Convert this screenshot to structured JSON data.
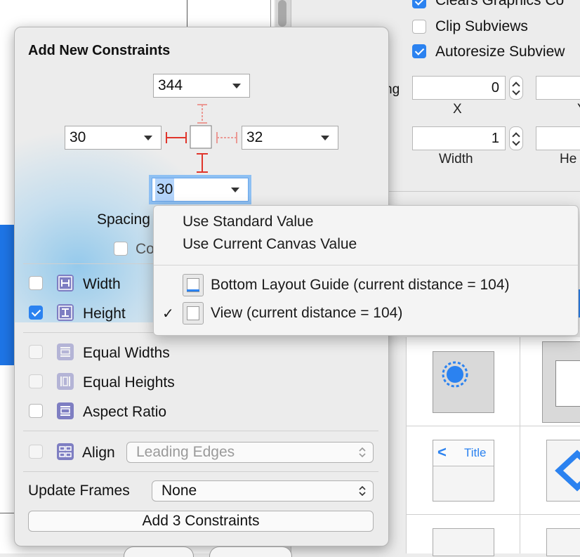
{
  "inspector": {
    "checkboxes": [
      {
        "label": "Clears Graphics Co",
        "checked": true
      },
      {
        "label": "Clip Subviews",
        "checked": false
      },
      {
        "label": "Autoresize Subview",
        "checked": true
      }
    ],
    "spacing_label_partial": "ng",
    "x_value": "0",
    "x_label": "X",
    "y_label_partial": "Y",
    "width_value": "1",
    "width_label": "Width",
    "height_label_partial": "He"
  },
  "object_library": {
    "nav_back_glyph": "<",
    "nav_title": "Title"
  },
  "popover": {
    "title": "Add New Constraints",
    "top_value": "344",
    "left_value": "30",
    "right_value": "32",
    "bottom_value": "30",
    "spacing_label_partial": "Spacing",
    "constrain_label_partial": "Co",
    "rows": [
      {
        "label": "Width",
        "checked": false,
        "enabled": true,
        "icon": "width-constraint-icon"
      },
      {
        "label": "Height",
        "checked": true,
        "enabled": true,
        "icon": "height-constraint-icon"
      },
      {
        "label": "Equal Widths",
        "checked": false,
        "enabled": false,
        "icon": "equal-widths-icon"
      },
      {
        "label": "Equal Heights",
        "checked": false,
        "enabled": false,
        "icon": "equal-heights-icon"
      },
      {
        "label": "Aspect Ratio",
        "checked": false,
        "enabled": true,
        "icon": "aspect-ratio-icon"
      }
    ],
    "align": {
      "label": "Align",
      "value": "Leading Edges",
      "enabled": false
    },
    "update_frames": {
      "label": "Update Frames",
      "value": "None"
    },
    "add_button": "Add 3 Constraints"
  },
  "menu": {
    "items": [
      {
        "label": "Use Standard Value"
      },
      {
        "label": "Use Current Canvas Value"
      }
    ],
    "targets": [
      {
        "label": "Bottom Layout Guide (current distance = 104)",
        "checked": false
      },
      {
        "label": "View (current distance = 104)",
        "checked": true
      }
    ],
    "checkmark": "✓"
  },
  "colors": {
    "accent": "#2b82f0",
    "constraint_red": "#e0352b",
    "icon_purple": "#7e7ec2"
  }
}
